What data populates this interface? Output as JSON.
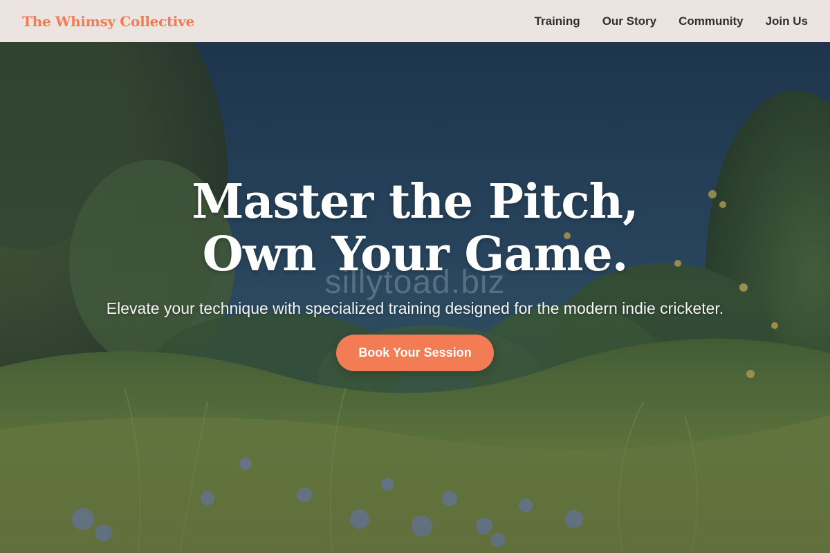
{
  "nav": {
    "brand": "The Whimsy Collective",
    "links": [
      "Training",
      "Our Story",
      "Community",
      "Join Us"
    ]
  },
  "hero": {
    "headline": "Master the Pitch, Own Your Game.",
    "subtitle": "Elevate your technique with specialized training designed for the modern indie cricketer.",
    "cta_label": "Book Your Session",
    "watermark": "sillytoad.biz"
  },
  "colors": {
    "brand": "#f07c56",
    "accent": "#f47c55",
    "navbar_bg": "#ebe4e0",
    "sky": "#2d4e6e",
    "foliage": "#5a7a3a"
  }
}
